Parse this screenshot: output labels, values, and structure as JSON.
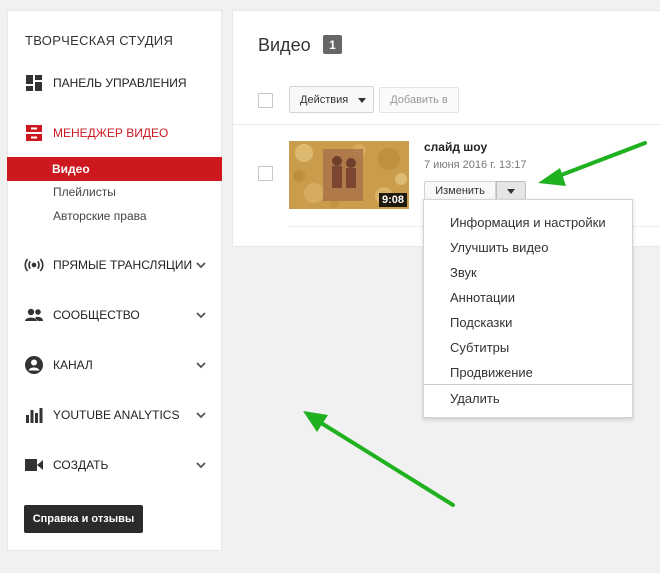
{
  "sidebar": {
    "studio_title": "ТВОРЧЕСКАЯ СТУДИЯ",
    "items": [
      {
        "label": "ПАНЕЛЬ УПРАВЛЕНИЯ",
        "icon": "dashboard-icon"
      },
      {
        "label": "МЕНЕДЖЕР ВИДЕО",
        "icon": "video-manager-icon"
      },
      {
        "label": "ПРЯМЫЕ ТРАНСЛЯЦИИ",
        "icon": "live-broadcast-icon"
      },
      {
        "label": "СООБЩЕСТВО",
        "icon": "community-icon"
      },
      {
        "label": "КАНАЛ",
        "icon": "channel-icon"
      },
      {
        "label": "YOUTUBE ANALYTICS",
        "icon": "analytics-icon"
      },
      {
        "label": "СОЗДАТЬ",
        "icon": "create-icon"
      }
    ],
    "sub_items": [
      "Видео",
      "Плейлисты",
      "Авторские права"
    ],
    "help_button": "Справка и отзывы",
    "accent_color": "#cc181e"
  },
  "main": {
    "title": "Видео",
    "count": "1",
    "actions_button": "Действия",
    "add_to_button": "Добавить в",
    "video": {
      "title": "слайд шоу",
      "date": "7 июня 2016 г. 13:17",
      "duration": "9:08",
      "edit_button": "Изменить"
    }
  },
  "dropdown": {
    "items": [
      "Информация и настройки",
      "Улучшить видео",
      "Звук",
      "Аннотации",
      "Подсказки",
      "Субтитры",
      "Продвижение"
    ],
    "delete": "Удалить"
  },
  "annotation_color": "#1fb11f"
}
